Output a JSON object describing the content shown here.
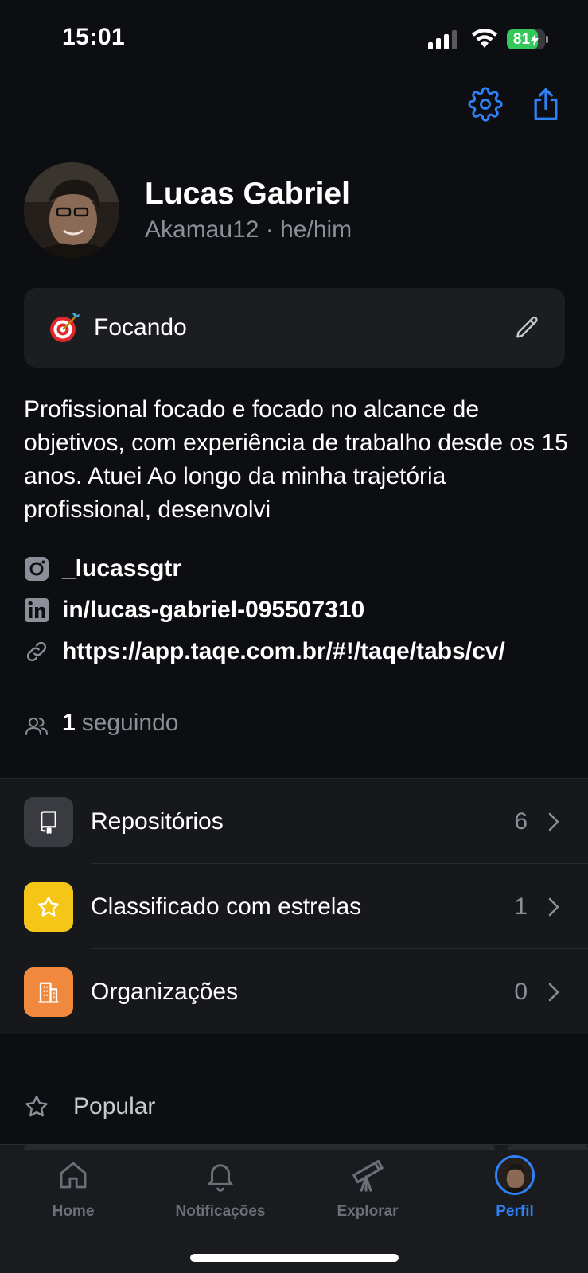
{
  "status_bar": {
    "time": "15:01",
    "battery": "81",
    "battery_level": 0.81
  },
  "profile": {
    "name": "Lucas Gabriel",
    "username": "Akamau12",
    "separator": "·",
    "pronouns": "he/him"
  },
  "status": {
    "text": "Focando",
    "emoji": "target-emoji"
  },
  "bio": "Profissional focado e focado no alcance de objetivos, com experiência de trabalho desde os 15 anos. Atuei Ao longo da minha trajetória profissional, desenvolvi",
  "links": {
    "instagram": "_lucassgtr",
    "linkedin": "in/lucas-gabriel-095507310",
    "website": "https://app.taqe.com.br/#!/taqe/tabs/cv/"
  },
  "following": {
    "count": "1",
    "label": "seguindo"
  },
  "menu": [
    {
      "label": "Repositórios",
      "count": "6",
      "icon": "repo-icon",
      "color": "#3a3b41"
    },
    {
      "label": "Classificado com estrelas",
      "count": "1",
      "icon": "star-icon",
      "color": "#f5c518"
    },
    {
      "label": "Organizações",
      "count": "0",
      "icon": "organization-icon",
      "color": "#f0883e"
    }
  ],
  "popular": {
    "title": "Popular"
  },
  "tabs": [
    {
      "label": "Home",
      "icon": "home-icon"
    },
    {
      "label": "Notificações",
      "icon": "bell-icon"
    },
    {
      "label": "Explorar",
      "icon": "telescope-icon"
    },
    {
      "label": "Perfil",
      "icon": "avatar",
      "active": true
    }
  ],
  "colors": {
    "accent": "#2f81f7",
    "background": "#0d0e11",
    "muted": "#8b8f98"
  }
}
